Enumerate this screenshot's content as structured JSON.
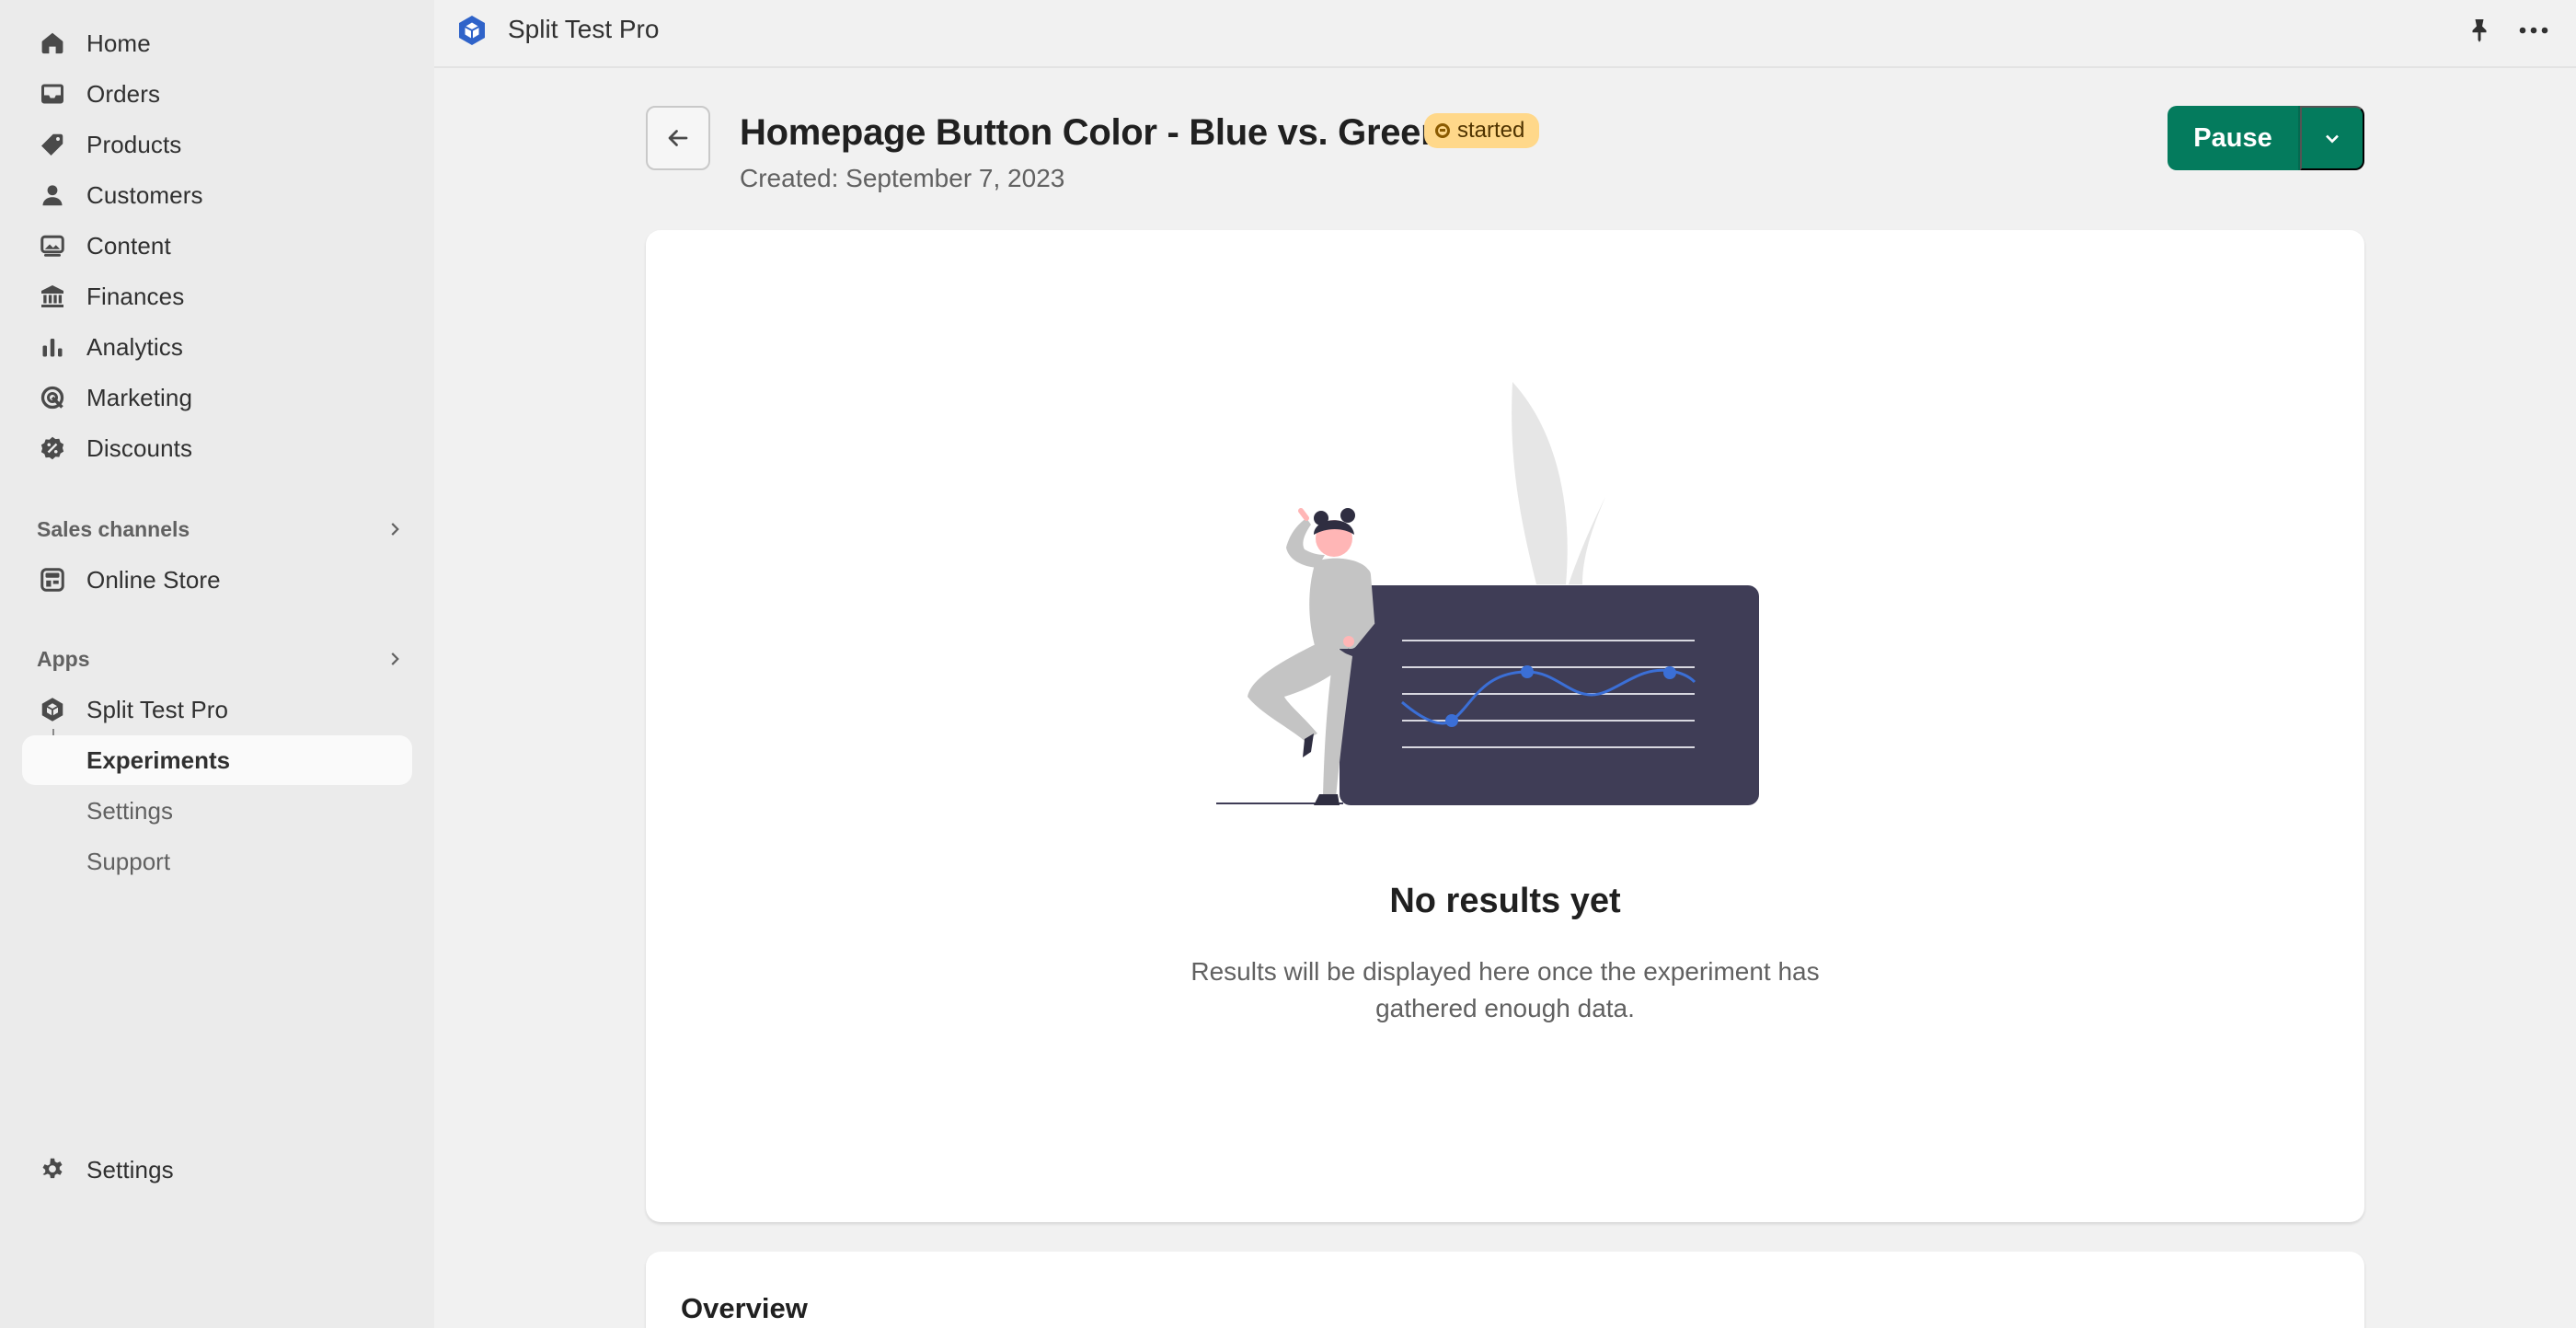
{
  "sidebar": {
    "nav": [
      {
        "label": "Home",
        "icon": "home-icon"
      },
      {
        "label": "Orders",
        "icon": "inbox-icon"
      },
      {
        "label": "Products",
        "icon": "tag-icon"
      },
      {
        "label": "Customers",
        "icon": "person-icon"
      },
      {
        "label": "Content",
        "icon": "image-icon"
      },
      {
        "label": "Finances",
        "icon": "bank-icon"
      },
      {
        "label": "Analytics",
        "icon": "bar-chart-icon"
      },
      {
        "label": "Marketing",
        "icon": "target-icon"
      },
      {
        "label": "Discounts",
        "icon": "discount-icon"
      }
    ],
    "sales_channels": {
      "label": "Sales channels",
      "items": [
        {
          "label": "Online Store",
          "icon": "store-icon"
        }
      ]
    },
    "apps": {
      "label": "Apps",
      "app": {
        "label": "Split Test Pro",
        "icon": "app-cube-icon"
      },
      "sub_items": [
        {
          "label": "Experiments",
          "active": true
        },
        {
          "label": "Settings",
          "active": false
        },
        {
          "label": "Support",
          "active": false
        }
      ]
    },
    "settings": {
      "label": "Settings",
      "icon": "gear-icon"
    }
  },
  "topbar": {
    "app_name": "Split Test Pro"
  },
  "header": {
    "title": "Homepage Button Color - Blue vs. Green",
    "status": "started",
    "created": "Created: September 7, 2023",
    "pause_label": "Pause"
  },
  "empty_state": {
    "title": "No results yet",
    "description": "Results will be displayed here once the experiment has gathered enough data."
  },
  "overview": {
    "title": "Overview"
  },
  "colors": {
    "primary": "#047b5d",
    "badge_bg": "#ffd88a",
    "illustration_panel": "#3f3d56",
    "illustration_accent": "#3b6fd6"
  }
}
